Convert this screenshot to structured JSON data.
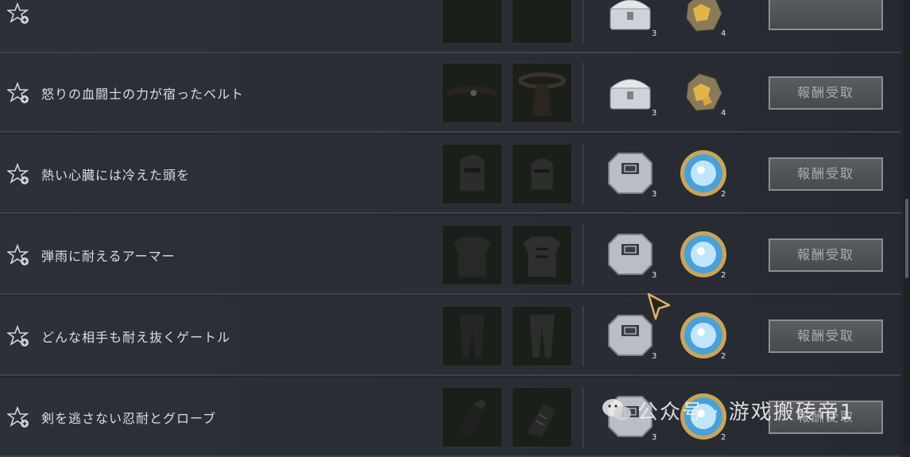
{
  "quests": [
    {
      "title": "",
      "item_count": "3",
      "reward_count": "4",
      "claim_label": ""
    },
    {
      "title": "怒りの血闘士の力が宿ったベルト",
      "item_count": "3",
      "reward_count": "4",
      "claim_label": "報酬受取"
    },
    {
      "title": "熱い心臓には冷えた頭を",
      "item_count": "3",
      "reward_count": "2",
      "claim_label": "報酬受取"
    },
    {
      "title": "弾雨に耐えるアーマー",
      "item_count": "3",
      "reward_count": "2",
      "claim_label": "報酬受取"
    },
    {
      "title": "どんな相手も耐え抜くゲートル",
      "item_count": "3",
      "reward_count": "2",
      "claim_label": "報酬受取"
    },
    {
      "title": "剣を逃さない忍耐とグローブ",
      "item_count": "3",
      "reward_count": "2",
      "claim_label": "報酬受取"
    }
  ],
  "icons": {
    "favorite": "star-plus-icon",
    "chest": "silver-chest-icon",
    "box": "silver-box-icon",
    "ore": "gold-ore-icon",
    "gem": "blue-gem-icon"
  },
  "watermark": {
    "text": "公众号 · 游戏搬砖帝1"
  },
  "colors": {
    "button_border": "#8a8d92",
    "row_bg": "#2c2f36",
    "text": "#dcdde0"
  }
}
